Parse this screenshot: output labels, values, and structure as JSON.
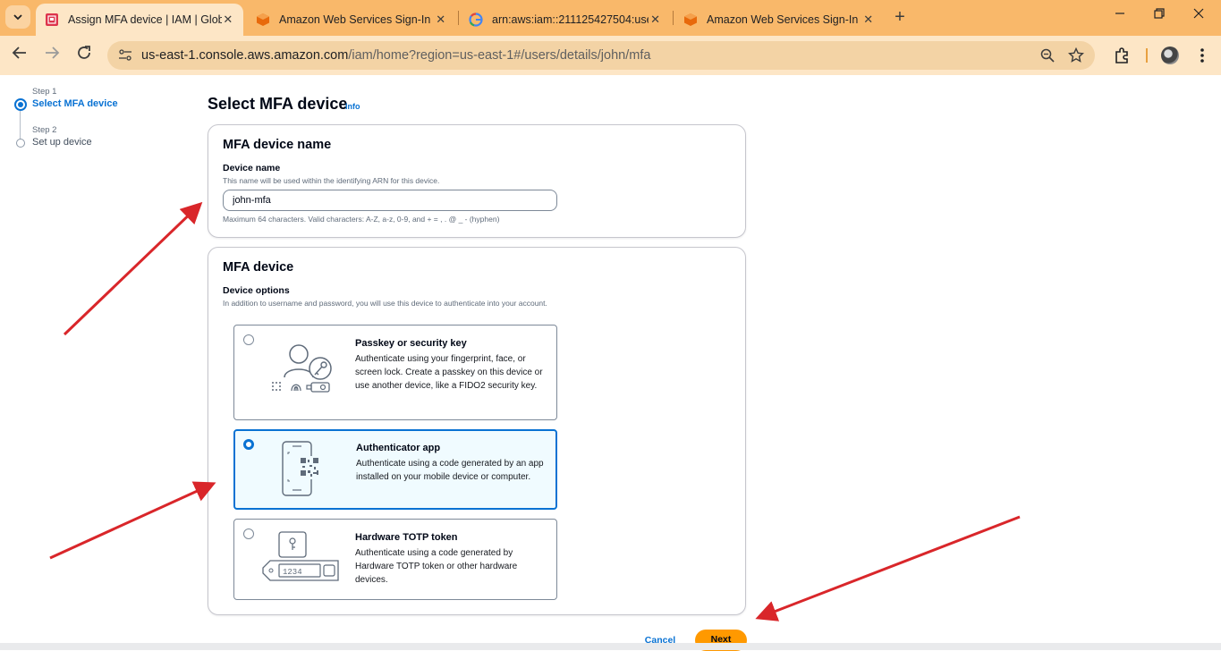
{
  "browser": {
    "tabs": [
      {
        "title": "Assign MFA device | IAM | Glob",
        "icon": "aws-iam-icon",
        "active": true
      },
      {
        "title": "Amazon Web Services Sign-In",
        "icon": "aws-box-icon",
        "active": false
      },
      {
        "title": "arn:aws:iam::211125427504:use",
        "icon": "google-icon",
        "active": false
      },
      {
        "title": "Amazon Web Services Sign-In",
        "icon": "aws-box-icon",
        "active": false
      }
    ],
    "tab_close": "✕",
    "new_tab": "+",
    "url_host": "us-east-1.console.aws.amazon.com",
    "url_path": "/iam/home?region=us-east-1#/users/details/john/mfa",
    "colors": {
      "tabbar": "#f9b86a",
      "toolbar": "#fde6c6"
    }
  },
  "wizard": {
    "steps": [
      {
        "small": "Step 1",
        "label": "Select MFA device",
        "state": "current"
      },
      {
        "small": "Step 2",
        "label": "Set up device",
        "state": "pending"
      }
    ]
  },
  "main": {
    "title": "Select MFA device",
    "info": "Info",
    "name_card": {
      "heading": "MFA device name",
      "field_label": "Device name",
      "field_desc": "This name will be used within the identifying ARN for this device.",
      "field_value": "john-mfa",
      "constraint": "Maximum 64 characters. Valid characters: A-Z, a-z, 0-9, and + = , . @ _ - (hyphen)"
    },
    "device_card": {
      "heading": "MFA device",
      "field_label": "Device options",
      "field_desc": "In addition to username and password, you will use this device to authenticate into your account.",
      "options": [
        {
          "title": "Passkey or security key",
          "desc": "Authenticate using your fingerprint, face, or screen lock. Create a passkey on this device or use another device, like a FIDO2 security key.",
          "selected": false
        },
        {
          "title": "Authenticator app",
          "desc": "Authenticate using a code generated by an app installed on your mobile device or computer.",
          "selected": true
        },
        {
          "title": "Hardware TOTP token",
          "desc": "Authenticate using a code generated by Hardware TOTP token or other hardware devices.",
          "selected": false,
          "token_display": "1234"
        }
      ]
    },
    "actions": {
      "cancel": "Cancel",
      "next": "Next"
    },
    "accent": "#0972d3",
    "primary": "#ff9900"
  },
  "annotation_color": "#d9262a"
}
